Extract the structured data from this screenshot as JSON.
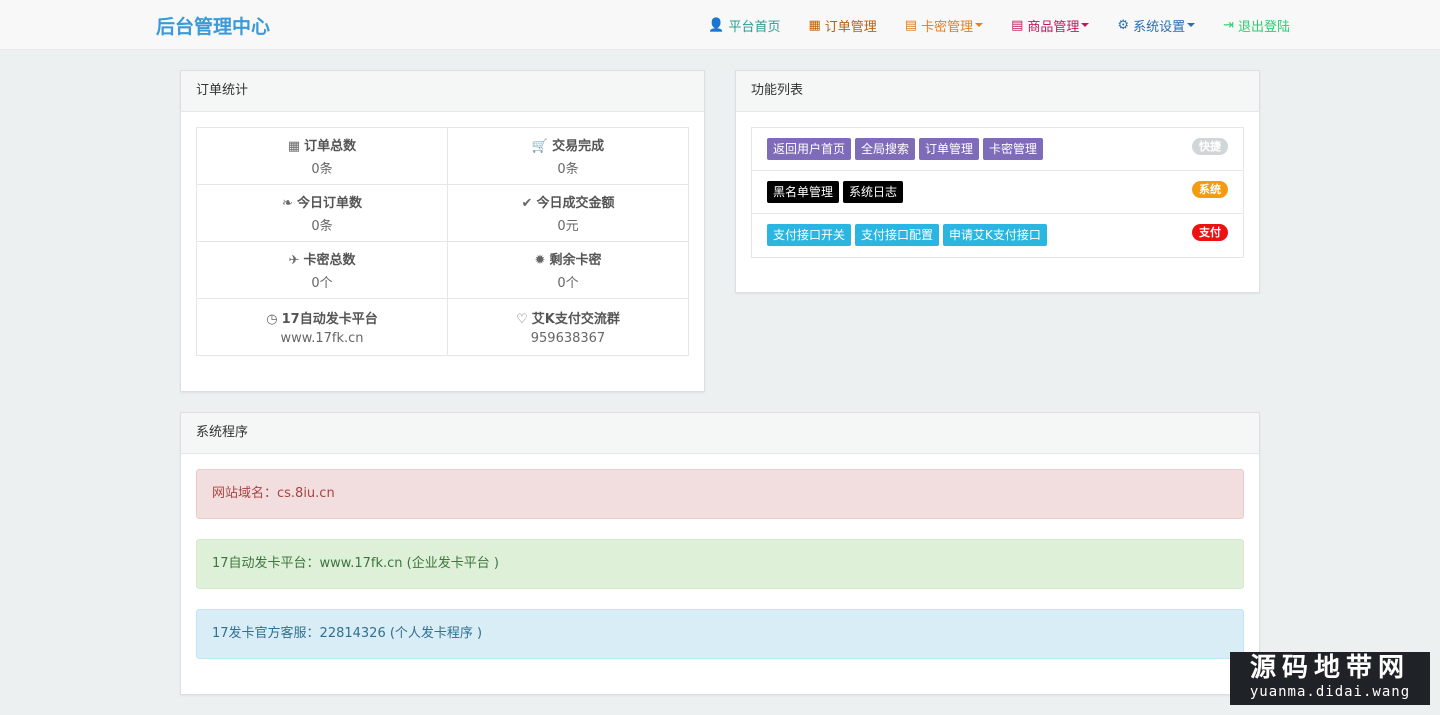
{
  "brand": "后台管理中心",
  "nav": [
    {
      "label": "平台首页",
      "icon": "👤",
      "color": "#2a9d8f",
      "caret": false,
      "name": "nav-home"
    },
    {
      "label": "订单管理",
      "icon": "▦",
      "color": "#b9620a",
      "caret": false,
      "name": "nav-orders"
    },
    {
      "label": "卡密管理",
      "icon": "▤",
      "color": "#e67e22",
      "caret": true,
      "name": "nav-cards"
    },
    {
      "label": "商品管理",
      "icon": "▤",
      "color": "#c2185b",
      "caret": true,
      "name": "nav-products"
    },
    {
      "label": "系统设置",
      "icon": "⚙",
      "color": "#2b6cb0",
      "caret": true,
      "name": "nav-settings"
    },
    {
      "label": "退出登陆",
      "icon": "⇥",
      "color": "#2ecc71",
      "caret": false,
      "name": "nav-logout"
    }
  ],
  "order_stats": {
    "heading": "订单统计",
    "rows": [
      [
        {
          "title": "订单总数",
          "icon": "▦",
          "value": "0条"
        },
        {
          "title": "交易完成",
          "icon": "🛒",
          "value": "0条"
        }
      ],
      [
        {
          "title": "今日订单数",
          "icon": "❧",
          "value": "0条"
        },
        {
          "title": "今日成交金额",
          "icon": "✔",
          "value": "0元"
        }
      ],
      [
        {
          "title": "卡密总数",
          "icon": "✈",
          "value": "0个"
        },
        {
          "title": "剩余卡密",
          "icon": "✹",
          "value": "0个"
        }
      ],
      [
        {
          "title": "17自动发卡平台",
          "icon": "◷",
          "value": "www.17fk.cn"
        },
        {
          "title": "艾K支付交流群",
          "icon": "♡",
          "value": "959638367"
        }
      ]
    ]
  },
  "func_list": {
    "heading": "功能列表",
    "rows": [
      {
        "buttons": [
          "返回用户首页",
          "全局搜索",
          "订单管理",
          "卡密管理"
        ],
        "btn_color": "#7e6cbb",
        "badge": "快捷",
        "badge_color": "#d2d6d9"
      },
      {
        "buttons": [
          "黑名单管理",
          "系统日志"
        ],
        "btn_color": "#000000",
        "badge": "系统",
        "badge_color": "#f39c12"
      },
      {
        "buttons": [
          "支付接口开关",
          "支付接口配置",
          "申请艾K支付接口"
        ],
        "btn_color": "#2bb6e2",
        "badge": "支付",
        "badge_color": "#ee1111"
      }
    ]
  },
  "system": {
    "heading": "系统程序",
    "alerts": [
      {
        "text": "网站域名：cs.8iu.cn",
        "bg": "#f2dede",
        "border": "#ebccd1",
        "color": "#a94442"
      },
      {
        "text": "17自动发卡平台：www.17fk.cn (企业发卡平台 )",
        "bg": "#dff0d8",
        "border": "#d6e9c6",
        "color": "#3c763d"
      },
      {
        "text": "17发卡官方客服：22814326 (个人发卡程序 )",
        "bg": "#d9edf7",
        "border": "#bce8f1",
        "color": "#31708f"
      }
    ]
  },
  "watermark": {
    "title": "源码地带网",
    "sub": "yuanma.didai.wang"
  }
}
